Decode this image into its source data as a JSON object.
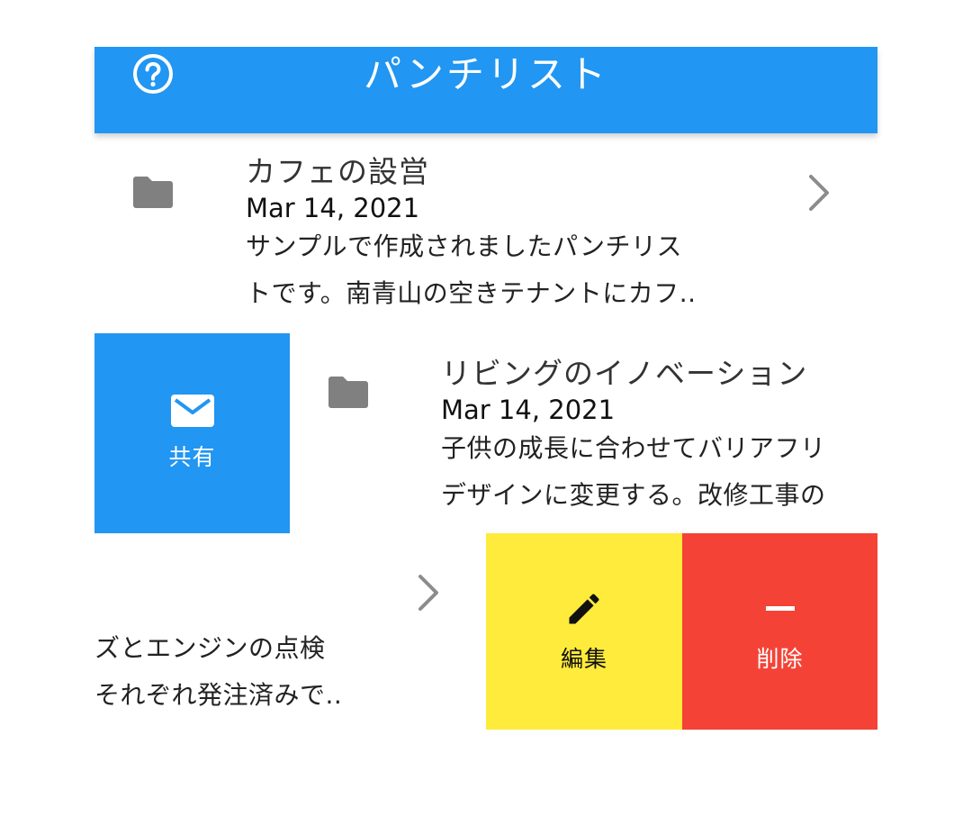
{
  "header": {
    "title": "パンチリスト",
    "help_icon": "help-circle-icon"
  },
  "items": [
    {
      "title": "カフェの設営",
      "date": "Mar 14, 2021",
      "description": "サンプルで作成されましたパンチリス\nトです。南青山の空きテナントにカフ..",
      "icon": "folder-icon"
    },
    {
      "title": "リビングのイノベーション",
      "date": "Mar 14, 2021",
      "description": "子供の成長に合わせてバリアフリ\nデザインに変更する。改修工事の",
      "icon": "folder-icon"
    },
    {
      "description": "ズとエンジンの点検\nそれぞれ発注済みで..",
      "icon": "folder-icon"
    }
  ],
  "actions": {
    "share": {
      "label": "共有",
      "icon": "mail-icon",
      "color": "#2196f3"
    },
    "edit": {
      "label": "編集",
      "icon": "pencil-icon",
      "color": "#ffeb3b"
    },
    "delete": {
      "label": "削除",
      "icon": "minus-icon",
      "color": "#f44336"
    }
  },
  "colors": {
    "header": "#2196f3",
    "folder": "#808080",
    "chevron": "#8c8c8c"
  }
}
